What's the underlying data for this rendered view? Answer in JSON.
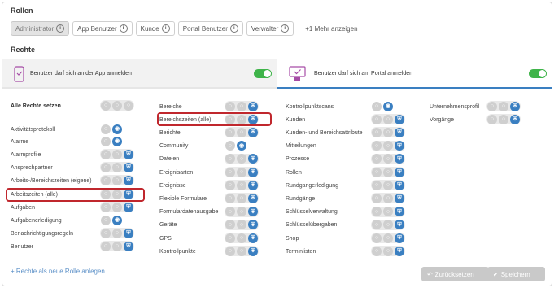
{
  "roles": {
    "heading": "Rollen",
    "items": [
      {
        "label": "Administrator",
        "active": true
      },
      {
        "label": "App Benutzer",
        "active": false
      },
      {
        "label": "Kunde",
        "active": false
      },
      {
        "label": "Portal Benutzer",
        "active": false
      },
      {
        "label": "Verwalter",
        "active": false
      }
    ],
    "info_glyph": "i",
    "more": "+1 Mehr anzeigen"
  },
  "rights": {
    "heading": "Rechte",
    "app_panel": {
      "text": "Benutzer darf sich an der App anmelden",
      "icon": "phone-check-icon",
      "enabled": true
    },
    "portal_panel": {
      "text": "Benutzer darf sich am Portal anmelden",
      "icon": "monitor-check-icon",
      "enabled": true
    }
  },
  "permission_columns": [
    {
      "items": [
        {
          "label": "Alle Rechte setzen",
          "bold": true,
          "icons": [
            "off",
            "off",
            "off"
          ]
        },
        {
          "label": "Aktivitätsprotokoll",
          "icons": [
            "off",
            "eye"
          ]
        },
        {
          "label": "Alarme",
          "icons": [
            "off",
            "eye"
          ]
        },
        {
          "label": "Alarmprofile",
          "icons": [
            "off",
            "off",
            "shield"
          ]
        },
        {
          "label": "Ansprechpartner",
          "icons": [
            "off",
            "off",
            "shield"
          ]
        },
        {
          "label": "Arbeits-/Bereichszeiten (eigene)",
          "icons": [
            "off",
            "off",
            "shield"
          ]
        },
        {
          "label": "Arbeitszeiten (alle)",
          "icons": [
            "off",
            "off",
            "shield"
          ],
          "highlighted": true
        },
        {
          "label": "Aufgaben",
          "icons": [
            "off",
            "off",
            "shield"
          ]
        },
        {
          "label": "Aufgabenerledigung",
          "icons": [
            "off",
            "eye"
          ]
        },
        {
          "label": "Benachrichtigungsregeln",
          "icons": [
            "off",
            "off",
            "shield"
          ]
        },
        {
          "label": "Benutzer",
          "icons": [
            "off",
            "off",
            "shield"
          ]
        }
      ]
    },
    {
      "items": [
        {
          "label": "Bereiche",
          "icons": [
            "off",
            "off",
            "shield"
          ]
        },
        {
          "label": "Bereichszeiten (alle)",
          "icons": [
            "off",
            "off",
            "shield"
          ],
          "highlighted": true
        },
        {
          "label": "Berichte",
          "icons": [
            "off",
            "off",
            "shield"
          ]
        },
        {
          "label": "Community",
          "icons": [
            "off",
            "eye"
          ]
        },
        {
          "label": "Dateien",
          "icons": [
            "off",
            "off",
            "shield"
          ]
        },
        {
          "label": "Ereignisarten",
          "icons": [
            "off",
            "off",
            "shield"
          ]
        },
        {
          "label": "Ereignisse",
          "icons": [
            "off",
            "off",
            "shield"
          ]
        },
        {
          "label": "Flexible Formulare",
          "icons": [
            "off",
            "off",
            "shield"
          ]
        },
        {
          "label": "Formulardatenausgabe",
          "icons": [
            "off",
            "off",
            "shield"
          ]
        },
        {
          "label": "Geräte",
          "icons": [
            "off",
            "off",
            "shield"
          ]
        },
        {
          "label": "GPS",
          "icons": [
            "off",
            "off",
            "shield"
          ]
        },
        {
          "label": "Kontrollpunkte",
          "icons": [
            "off",
            "off",
            "shield"
          ]
        }
      ]
    },
    {
      "items": [
        {
          "label": "Kontrollpunktscans",
          "icons": [
            "off",
            "eye"
          ]
        },
        {
          "label": "Kunden",
          "icons": [
            "off",
            "off",
            "shield"
          ]
        },
        {
          "label": "Kunden- und Bereichsattribute",
          "icons": [
            "off",
            "off",
            "shield"
          ]
        },
        {
          "label": "Mitteilungen",
          "icons": [
            "off",
            "off",
            "shield"
          ]
        },
        {
          "label": "Prozesse",
          "icons": [
            "off",
            "off",
            "shield"
          ]
        },
        {
          "label": "Rollen",
          "icons": [
            "off",
            "off",
            "shield"
          ]
        },
        {
          "label": "Rundgangerledigung",
          "icons": [
            "off",
            "off",
            "shield"
          ]
        },
        {
          "label": "Rundgänge",
          "icons": [
            "off",
            "off",
            "shield"
          ]
        },
        {
          "label": "Schlüsselverwaltung",
          "icons": [
            "off",
            "off",
            "shield"
          ]
        },
        {
          "label": "Schlüsselübergaben",
          "icons": [
            "off",
            "off",
            "shield"
          ]
        },
        {
          "label": "Shop",
          "icons": [
            "off",
            "off",
            "shield"
          ]
        },
        {
          "label": "Terminlisten",
          "icons": [
            "off",
            "off",
            "shield"
          ]
        }
      ]
    },
    {
      "items": [
        {
          "label": "Unternehmensprofil",
          "icons": [
            "off",
            "off",
            "shield"
          ]
        },
        {
          "label": "Vorgänge",
          "icons": [
            "off",
            "off",
            "shield"
          ]
        }
      ]
    }
  ],
  "footer": {
    "add_role_link": "+ Rechte als neue Rolle anlegen",
    "reset_label": "Zurücksetzen",
    "save_label": "Speichern"
  },
  "colors": {
    "accent": "#3a7fc1",
    "toggle_on": "#3fb44a",
    "highlight": "#c0272d",
    "disabled_button": "#c9c9c9"
  }
}
